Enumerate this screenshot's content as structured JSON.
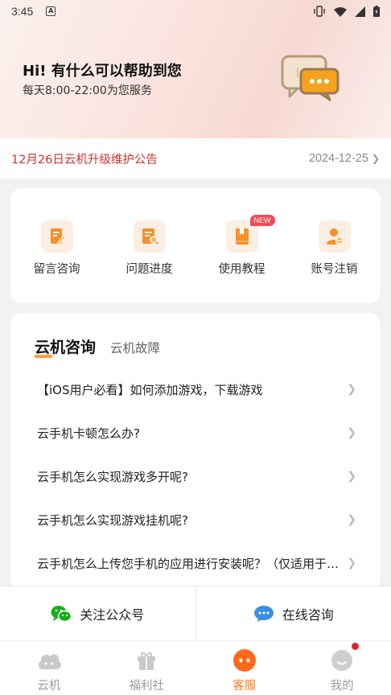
{
  "status_bar": {
    "time": "3:45",
    "badge": "A"
  },
  "header": {
    "greeting": "Hi! 有什么可以帮助到您",
    "service_hours": "每天8:00-22:00为您服务"
  },
  "notice": {
    "title": "12月26日云机升级维护公告",
    "date": "2024-12-25"
  },
  "quick_actions": [
    {
      "label": "留言咨询",
      "icon": "message-edit-icon"
    },
    {
      "label": "问题进度",
      "icon": "progress-search-icon"
    },
    {
      "label": "使用教程",
      "icon": "tutorial-book-icon",
      "badge": "NEW"
    },
    {
      "label": "账号注销",
      "icon": "account-remove-icon"
    }
  ],
  "faq": {
    "tabs": [
      {
        "label": "云机咨询",
        "active": true
      },
      {
        "label": "云机故障",
        "active": false
      }
    ],
    "questions": [
      "【iOS用户必看】如何添加游戏，下载游戏",
      "云手机卡顿怎么办?",
      "云手机怎么实现游戏多开呢?",
      "云手机怎么实现游戏挂机呢?",
      "云手机怎么上传您手机的应用进行安装呢？（仅适用于安卓手机）"
    ]
  },
  "contact": {
    "wechat_label": "关注公众号",
    "online_label": "在线咨询"
  },
  "bottom_nav": [
    {
      "label": "云机",
      "icon": "cloud-gamepad-icon",
      "active": false
    },
    {
      "label": "福利社",
      "icon": "gift-icon",
      "active": false
    },
    {
      "label": "客服",
      "icon": "customer-service-icon",
      "active": true
    },
    {
      "label": "我的",
      "icon": "profile-icon",
      "active": false,
      "notification_dot": true
    }
  ],
  "colors": {
    "accent": "#ff7a1a",
    "notice_red": "#d0312d",
    "icon_bg": "#fdeee3",
    "icon_orange": "#f5902a",
    "new_badge": "#f14a5a",
    "wechat_green": "#1aad19",
    "chat_blue": "#3a8ee6"
  }
}
